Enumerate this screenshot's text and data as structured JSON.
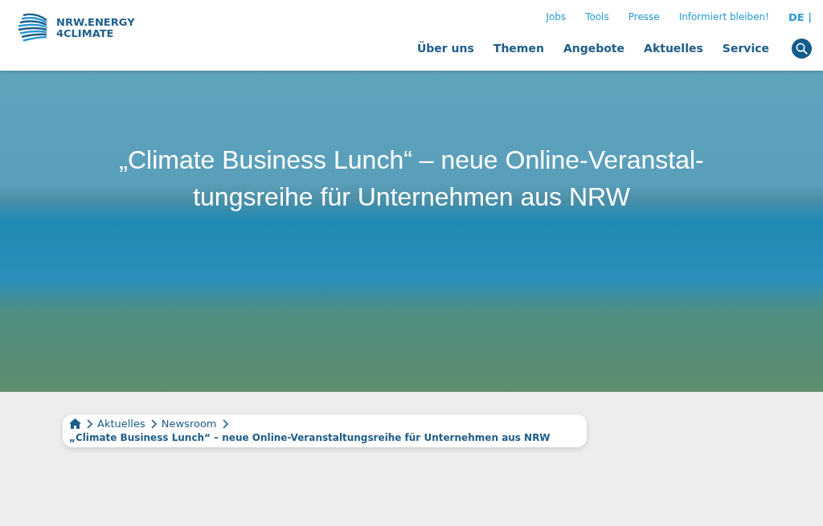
{
  "logo": {
    "line_1": "NRW.ENERGY",
    "line_2": "4CLIMATE"
  },
  "top_links": [
    "Jobs",
    "Tools",
    "Presse",
    "Informiert bleiben!"
  ],
  "language": {
    "label": "DE |",
    "selected": true
  },
  "main_nav": [
    "Über uns",
    "Themen",
    "Angebote",
    "Aktuelles",
    "Service"
  ],
  "hero": {
    "title_lines": [
      "„Climate Business Lunch“ – neue Online-Veranstal-",
      "tungsreihe für Unternehmen aus NRW"
    ]
  },
  "breadcrumb": {
    "links": [
      "Aktuelles",
      "Newsroom"
    ],
    "current": "„Climate Business Lunch“ – neue Online-Veranstaltungsreihe für Unternehmen aus NRW"
  }
}
